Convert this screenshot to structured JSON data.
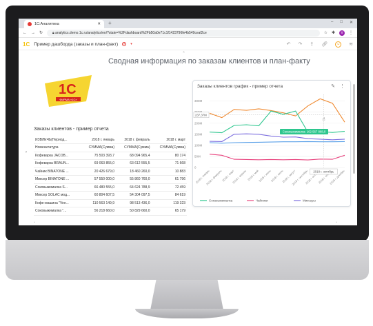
{
  "browser": {
    "tab_title": "1С:Аналитика",
    "new_tab": "+",
    "url": "analytics.demo.1c.ru/analytics/en/?state=%2Fdashboard%2Fb50a0e71c1f1423796fe4b549ceaf2ce",
    "profile_initial": "V"
  },
  "app": {
    "logo_text": "1С",
    "dashboard_name": "Пример дашборда (заказы и план-факт)"
  },
  "dashboard": {
    "title": "Сводная информация по заказам клиентов и план-факту",
    "brand_logo_text": "1С",
    "brand_logo_sub": "ФИРМА «1С»"
  },
  "table": {
    "title": "Заказы клиентов - пример отчета",
    "header_row1": [
      "ИЗВЛЕЧЬ(Период...",
      "2018 г. январь",
      "2018 г. февраль",
      "2018 г. март"
    ],
    "header_row2": [
      "Номенклатура",
      "СУММА(Сумма)",
      "СУММА(Сумма)",
      "СУММА(Сумма)"
    ],
    "rows": [
      [
        "Кофеварка JACOB...",
        "75 503 393,7",
        "68 094 965,4",
        "80 174"
      ],
      [
        "Кофеварка BRAUN...",
        "69 063 855,0",
        "63 612 555,5",
        "71 668"
      ],
      [
        "Чайник BINATONE ...",
        "20 426 679,0",
        "18 460 260,0",
        "10 883"
      ],
      [
        "Миксер BINATONE ...",
        "57 550 000,0",
        "55 860 760,0",
        "61 796"
      ],
      [
        "Соковыжималка S...",
        "66 480 555,0",
        "64 624 788,9",
        "72 459"
      ],
      [
        "Миксер SOLAC мод...",
        "60 804 607,5",
        "54 304 097,5",
        "84 619"
      ],
      [
        "Кофе-машина \"Vee...",
        "110 563 149,9",
        "98 513 436,0",
        "119 323"
      ],
      [
        "Соковыжималка \"...",
        "56 218 660,0",
        "50 829 660,0",
        "65 179"
      ]
    ]
  },
  "chart": {
    "title": "Заказы клиентов график - пример отчета",
    "crosshair_y_label": "237,37М",
    "crosshair_x_label": "2018 г. октябрь",
    "tooltip": "Соковыжималка: 162 567 868,0"
  },
  "chart_data": {
    "type": "line",
    "title": "Заказы клиентов график - пример отчета",
    "categories": [
      "2018 г. январь",
      "2018 г. февраль",
      "2018 г. март",
      "2018 г. апрель",
      "2018 г. май",
      "2018 г. июнь",
      "2018 г. июль",
      "2018 г. август",
      "2018 г. сентябрь",
      "2018 г. октябрь",
      "2018 г. ноябрь",
      "2018 г. декабрь"
    ],
    "y_ticks": [
      "0",
      "50M",
      "100M",
      "150M",
      "200M",
      "250M",
      "300M"
    ],
    "ylim": [
      0,
      330
    ],
    "series": [
      {
        "name": "",
        "color": "#f0892f",
        "values": [
          245,
          225,
          262,
          258,
          265,
          257,
          247,
          233,
          278,
          310,
          290,
          205
        ]
      },
      {
        "name": "Соковыжималка",
        "color": "#2dc68e",
        "values": [
          160,
          157,
          190,
          193,
          188,
          255,
          240,
          255,
          160,
          162,
          158,
          163
        ]
      },
      {
        "name": "Чайники",
        "color": "#e8457f",
        "values": [
          60,
          55,
          37,
          36,
          35,
          36,
          35,
          36,
          34,
          38,
          37,
          55
        ]
      },
      {
        "name": "Миксеры",
        "color": "#7d6fe0",
        "values": [
          118,
          117,
          150,
          152,
          150,
          142,
          137,
          138,
          130,
          128,
          125,
          128
        ]
      },
      {
        "name": "",
        "color": "#5aa0e8",
        "values": [
          112,
          110,
          112,
          113,
          114,
          115,
          116,
          116,
          117,
          116,
          116,
          117
        ]
      }
    ],
    "legend": [
      "Соковыжималка",
      "Чайники",
      "Миксеры"
    ],
    "legend_placement": "bottom",
    "grid": true
  }
}
